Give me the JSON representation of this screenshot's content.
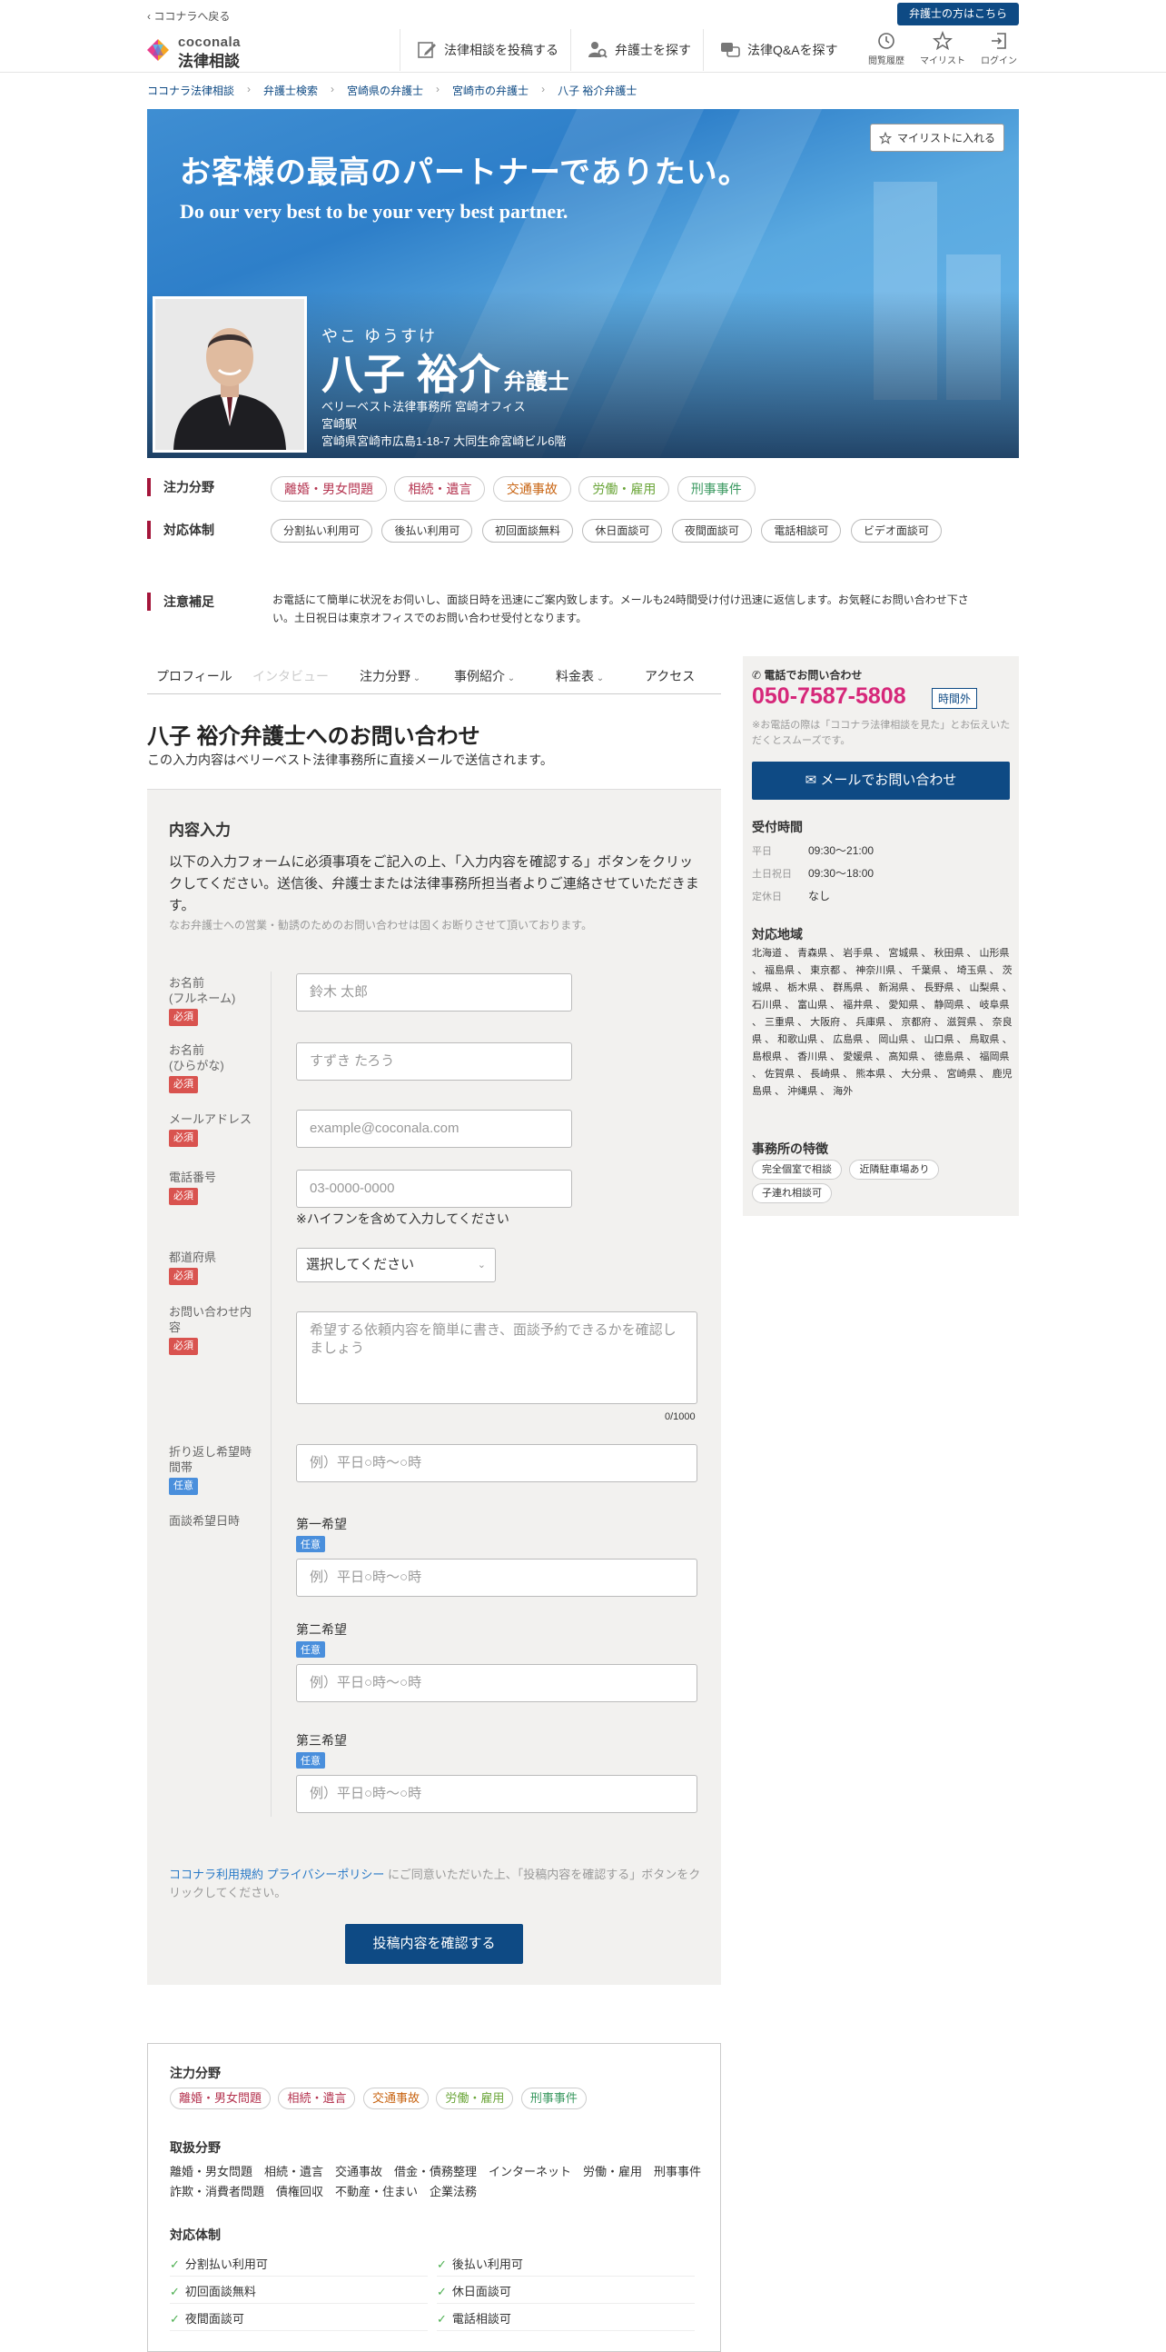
{
  "header": {
    "back": "ココナラへ戻る",
    "lawyer_link": "弁護士の方はこちら",
    "logo_top": "coconala",
    "logo_bottom": "法律相談",
    "nav": [
      "法律相談を投稿する",
      "弁護士を探す",
      "法律Q&Aを探す"
    ],
    "small_nav": [
      "閲覧履歴",
      "マイリスト",
      "ログイン"
    ]
  },
  "breadcrumb": [
    "ココナラ法律相談",
    "弁護士検索",
    "宮崎県の弁護士",
    "宮崎市の弁護士",
    "八子 裕介弁護士"
  ],
  "hero": {
    "catch_ja": "お客様の最高のパートナーでありたい。",
    "catch_en": "Do our very best to be your very best partner.",
    "mylist": "マイリストに入れる",
    "kana": "やこ ゆうすけ",
    "name": "八子 裕介",
    "title": "弁護士",
    "firm": "ベリーベスト法律事務所 宮崎オフィス",
    "station": "宮崎駅",
    "address": "宮崎県宮崎市広島1-18-7 大同生命宮崎ビル6階"
  },
  "profile": {
    "focus_label": "注力分野",
    "focus": [
      "離婚・男女問題",
      "相続・遺言",
      "交通事故",
      "労働・雇用",
      "刑事事件"
    ],
    "support_label": "対応体制",
    "support": [
      "分割払い利用可",
      "後払い利用可",
      "初回面談無料",
      "休日面談可",
      "夜間面談可",
      "電話相談可",
      "ビデオ面談可"
    ],
    "note_label": "注意補足",
    "note": "お電話にて簡単に状況をお伺いし、面談日時を迅速にご案内致します。メールも24時間受け付け迅速に返信します。お気軽にお問い合わせ下さい。土日祝日は東京オフィスでのお問い合わせ受付となります。"
  },
  "tabs": [
    "プロフィール",
    "インタビュー",
    "注力分野",
    "事例紹介",
    "料金表",
    "アクセス"
  ],
  "form": {
    "title": "八子 裕介弁護士へのお問い合わせ",
    "subtitle": "この入力内容はベリーベスト法律事務所に直接メールで送信されます。",
    "section": "内容入力",
    "intro": "以下の入力フォームに必須事項をご記入の上、「入力内容を確認する」ボタンをクリックしてください。送信後、弁護士または法律事務所担当者よりご連絡させていただきます。",
    "small": "なお弁護士への営業・勧誘のためのお問い合わせは固くお断りさせて頂いております。",
    "required": "必須",
    "optional": "任意",
    "fields": {
      "name_label_1": "お名前",
      "name_label_2": "(フルネーム)",
      "name_ph": "鈴木 太郎",
      "kana_label_1": "お名前",
      "kana_label_2": "(ひらがな)",
      "kana_ph": "すずき たろう",
      "email_label": "メールアドレス",
      "email_ph": "example@coconala.com",
      "tel_label": "電話番号",
      "tel_ph": "03-0000-0000",
      "tel_help": "※ハイフンを含めて入力してください",
      "pref_label": "都道府県",
      "pref_value": "選択してください",
      "body_label": "お問い合わせ内容",
      "body_ph": "希望する依頼内容を簡単に書き、面談予約できるかを確認しましょう",
      "counter": "0/1000",
      "callback_label": "折り返し希望時間帯",
      "callback_ph": "例）平日○時〜○時",
      "meeting_label": "面談希望日時",
      "first": "第一希望",
      "second": "第二希望",
      "third": "第三希望",
      "time_ph": "例）平日○時〜○時"
    },
    "agree_link": "ココナラ利用規約 プライバシーポリシー",
    "agree_text": "にご同意いただいた上、「投稿内容を確認する」ボタンをクリックしてください。",
    "submit": "投稿内容を確認する"
  },
  "sidebar": {
    "phone_label": "電話でお問い合わせ",
    "phone": "050-7587-5808",
    "phone_badge": "時間外",
    "phone_note": "※お電話の際は「ココナラ法律相談を見た」とお伝えいただくとスムーズです。",
    "mail_button": "メールでお問い合わせ",
    "hours_title": "受付時間",
    "hours": [
      {
        "day": "平日",
        "time": "09:30〜21:00"
      },
      {
        "day": "土日祝日",
        "time": "09:30〜18:00"
      },
      {
        "day": "定休日",
        "time": "なし"
      }
    ],
    "area_title": "対応地域",
    "area": "北海道 、 青森県 、 岩手県 、 宮城県 、 秋田県 、 山形県 、 福島県 、 東京都 、 神奈川県 、 千葉県 、 埼玉県 、 茨城県 、 栃木県 、 群馬県 、 新潟県 、 長野県 、 山梨県 、 石川県 、 富山県 、 福井県 、 愛知県 、 静岡県 、 岐阜県 、 三重県 、 大阪府 、 兵庫県 、 京都府 、 滋賀県 、 奈良県 、 和歌山県 、 広島県 、 岡山県 、 山口県 、 鳥取県 、 島根県 、 香川県 、 愛媛県 、 高知県 、 徳島県 、 福岡県 、 佐賀県 、 長崎県 、 熊本県 、 大分県 、 宮崎県 、 鹿児島県 、 沖縄県 、 海外",
    "features_title": "事務所の特徴",
    "features": [
      "完全個室で相談",
      "近隣駐車場あり",
      "子連れ相談可"
    ]
  },
  "bottom": {
    "focus_title": "注力分野",
    "focus": [
      "離婚・男女問題",
      "相続・遺言",
      "交通事故",
      "労働・雇用",
      "刑事事件"
    ],
    "fields_title": "取扱分野",
    "fields_text": "離婚・男女問題　相続・遺言　交通事故　借金・債務整理　インターネット　労働・雇用　刑事事件　詐欺・消費者問題　債権回収　不動産・住まい　企業法務",
    "support_title": "対応体制",
    "support": [
      "分割払い利用可",
      "後払い利用可",
      "初回面談無料",
      "休日面談可",
      "夜間面談可",
      "電話相談可"
    ]
  },
  "colors": {
    "brand": "#0e4a84",
    "accent": "#a4153a",
    "phone": "#d6287a",
    "required": "#d9534f",
    "optional": "#4a8fdc"
  }
}
